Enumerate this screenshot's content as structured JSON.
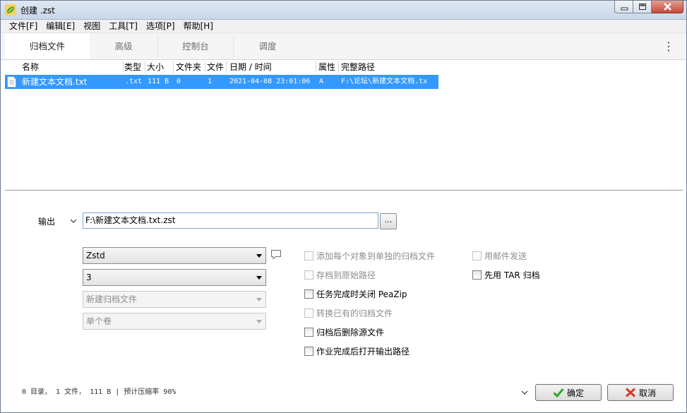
{
  "window": {
    "title": "创建 .zst"
  },
  "menu": [
    "文件[F]",
    "编辑[E]",
    "视图",
    "工具[T]",
    "选项[P]",
    "帮助[H]"
  ],
  "tabs": [
    "归档文件",
    "高级",
    "控制台",
    "调度"
  ],
  "columns": {
    "name": "名称",
    "type": "类型",
    "size": "大小",
    "folders": "文件夹",
    "files": "文件",
    "date": "日期 / 时间",
    "attr": "属性",
    "path": "完整路径"
  },
  "rows": [
    {
      "name": "新建文本文档.txt",
      "type": ".txt",
      "size": "111 B",
      "folders": "0",
      "files": "1",
      "date": "2021-04-08 23:01:06",
      "attr": "A",
      "path": "F:\\论坛\\新建文本文档.tx"
    }
  ],
  "output": {
    "label": "输出",
    "value": "F:\\新建文本文档.txt.zst",
    "browse": "..."
  },
  "combos": {
    "format": "Zstd",
    "level": "3",
    "mode": "新建归档文件",
    "volume": "单个卷"
  },
  "options": {
    "separate": "添加每个对象到单独的归档文件",
    "original_path": "存档到原始路径",
    "close_peazip": "任务完成时关闭 PeaZip",
    "convert": "转换已有的归档文件",
    "delete_source": "归档后删除源文件",
    "open_output": "作业完成后打开输出路径",
    "email": "用邮件发送",
    "tar_first": "先用 TAR 归档"
  },
  "status": "0 目录， 1 文件， 111 B | 预计压缩率 90%",
  "buttons": {
    "ok": "确定",
    "cancel": "取消"
  }
}
